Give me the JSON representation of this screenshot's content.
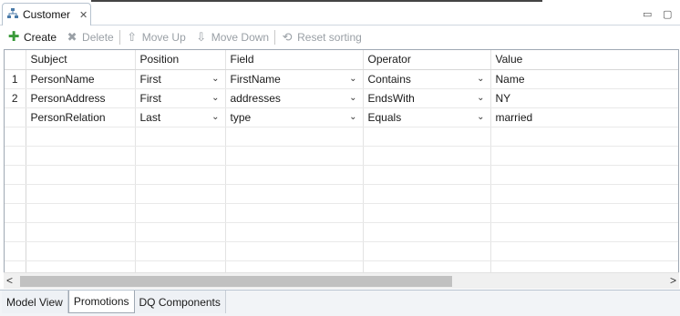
{
  "editor_tab": {
    "title": "Customer",
    "close_glyph": "✕",
    "icon": "hierarchy-icon"
  },
  "window_controls": {
    "minimize": "▭",
    "maximize": "▢"
  },
  "toolbar": {
    "create": "Create",
    "delete": "Delete",
    "move_up": "Move Up",
    "move_down": "Move Down",
    "reset_sorting": "Reset sorting"
  },
  "grid": {
    "columns": [
      "Subject",
      "Position",
      "Field",
      "Operator",
      "Value"
    ],
    "rows": [
      {
        "num": "1",
        "subject": "PersonName",
        "position": "First",
        "field": "FirstName",
        "operator": "Contains",
        "value": "Name"
      },
      {
        "num": "2",
        "subject": "PersonAddress",
        "position": "First",
        "field": "addresses",
        "operator": "EndsWith",
        "value": "NY"
      },
      {
        "num": "",
        "subject": "PersonRelation",
        "position": "Last",
        "field": "type",
        "operator": "Equals",
        "value": "married"
      }
    ],
    "empty_rows": 8
  },
  "scrollbar": {
    "left": "<",
    "right": ">"
  },
  "bottom_tabs": [
    "Model View",
    "Promotions",
    "DQ Components"
  ],
  "colors": {
    "accent_green": "#3a9a3a",
    "border": "#9fa8b3"
  }
}
